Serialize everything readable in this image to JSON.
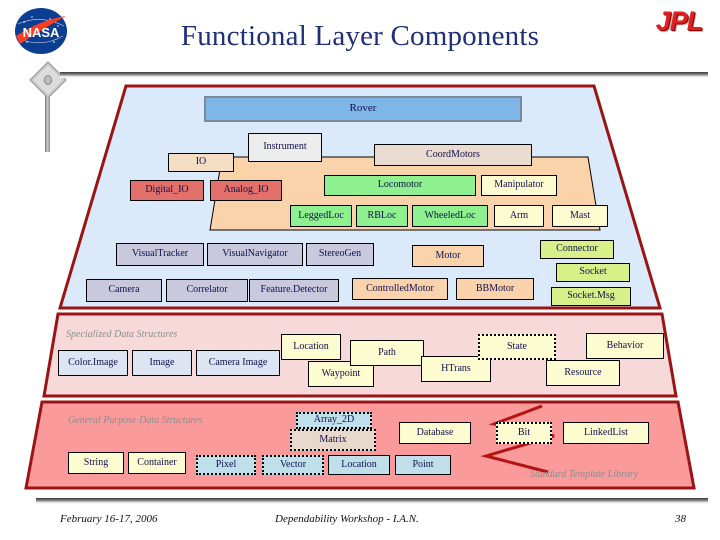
{
  "slide": {
    "title": "Functional Layer Components",
    "nasa_logo": "nasa-meatball-logo",
    "jpl_logo": "JPL"
  },
  "footer": {
    "date": "February 16-17, 2006",
    "event": "Dependability Workshop - I.A.N.",
    "page": "38"
  },
  "layers": {
    "top_label": "",
    "specialized_label": "Specialized Data Structures",
    "general_label": "General Purpose Data Structures",
    "stl_label": "Standard Template Library"
  },
  "colors": {
    "top_layer_fill": "#dbeafa",
    "mid_layer_fill": "#f7d9d9",
    "bottom_layer_fill": "#fb9a9a",
    "layer_border": "#9b1414",
    "inner_trapezoid_fill": "#fbd3ab",
    "title_color": "#1f2f7a",
    "jpl_red": "#e02020"
  },
  "boxes": {
    "rover": "Rover",
    "instrument": "Instrument",
    "coord_motors": "CoordMotors",
    "io": "IO",
    "digital_io": "Digital_IO",
    "analog_io": "Analog_IO",
    "locomotor": "Locomotor",
    "manipulator": "Manipulator",
    "legged_loc": "LeggedLoc",
    "rb_loc": "RBLoc",
    "wheeled_loc": "WheeledLoc",
    "arm": "Arm",
    "mast": "Mast",
    "visual_tracker": "VisualTracker",
    "visual_navigator": "VisualNavigator",
    "stereo_gen": "StereoGen",
    "motor": "Motor",
    "connector": "Connector",
    "socket": "Socket",
    "socket_msg": "Socket.Msg",
    "camera": "Camera",
    "correlator": "Correlator",
    "feature_detector": "Feature.Detector",
    "controlled_motor": "ControlledMotor",
    "bb_motor": "BBMotor",
    "color_image": "Color.Image",
    "image": "Image",
    "camera_image": "Camera Image",
    "location_spec": "Location",
    "waypoint": "Waypoint",
    "path": "Path",
    "htrans": "HTrans",
    "state": "State",
    "resource": "Resource",
    "behavior": "Behavior",
    "array_2d": "Array_2D",
    "matrix": "Matrix",
    "database": "Database",
    "bit": "Bit",
    "linked_list": "LinkedList",
    "string": "String",
    "container": "Container",
    "pixel": "Pixel",
    "vector": "Vector",
    "location_gen": "Location",
    "point": "Point"
  }
}
